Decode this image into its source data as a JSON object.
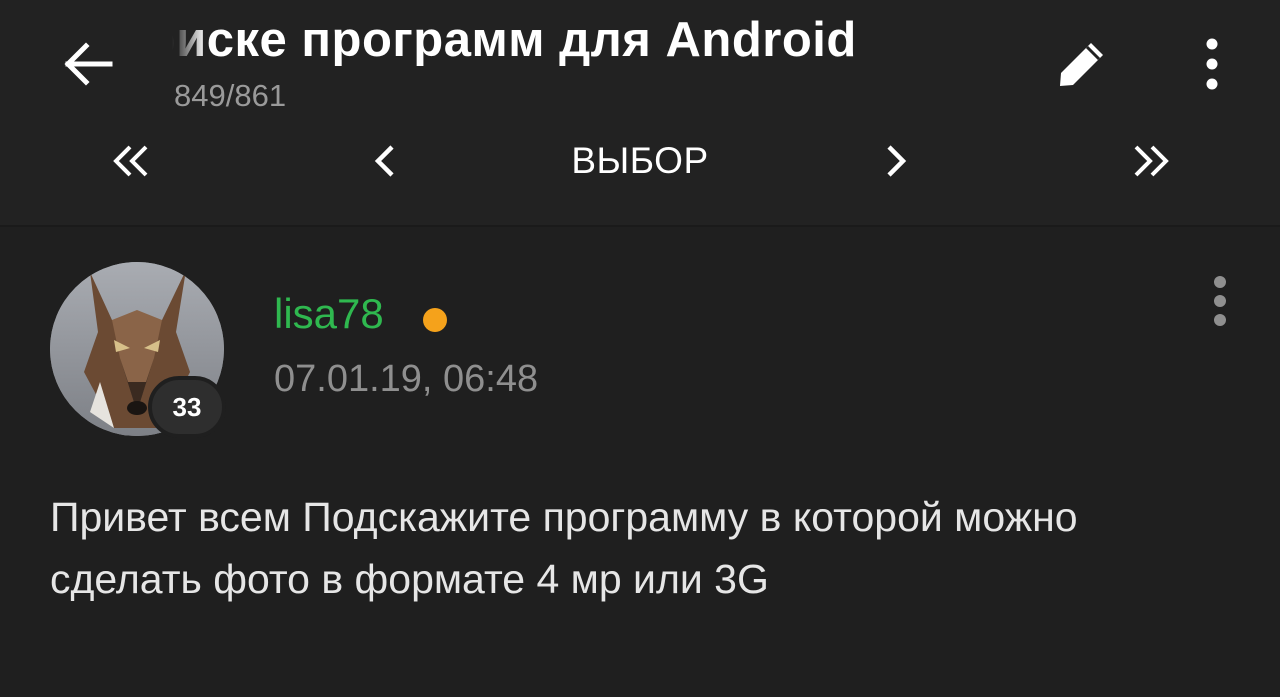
{
  "header": {
    "title": "Поиске программ для Android",
    "counter": "849/861",
    "back_icon": "arrow-left-icon",
    "edit_icon": "pencil-icon",
    "more_icon": "more-vertical-icon"
  },
  "pager": {
    "first": "«",
    "prev": "‹",
    "select_label": "ВЫБОР",
    "next": "›",
    "last": "»"
  },
  "post": {
    "author": "lisa78",
    "reputation": "33",
    "date": "07.01.19, 06:48",
    "text": "Привет всем Подскажите программу в которой можно сделать фото в формате 4 мр или 3G",
    "online_color": "#f5a21b",
    "author_color": "#2fb84f"
  }
}
